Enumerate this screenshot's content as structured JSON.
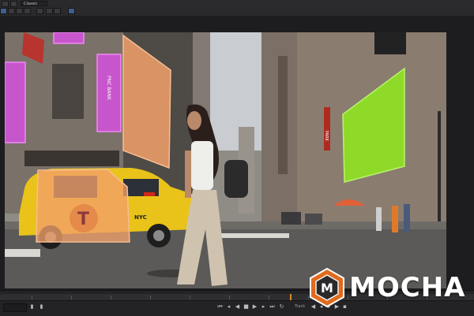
{
  "toolbar": {
    "preset": "Classic"
  },
  "viewer": {
    "signs": {
      "pnc_bank": "PNC BANK",
      "taxi_letter": "T",
      "taxi_nyc": "NYC",
      "park": "PARK"
    }
  },
  "transport": {
    "track_label": "Track"
  },
  "logo": {
    "text": "MOCHA",
    "mark": "M"
  },
  "colors": {
    "mask_magenta": "#d84fe0",
    "mask_orange": "#f2a06a",
    "mask_green": "#8fe61e",
    "taxi_yellow": "#e9c31a",
    "logo_orange": "#e06a1e"
  }
}
